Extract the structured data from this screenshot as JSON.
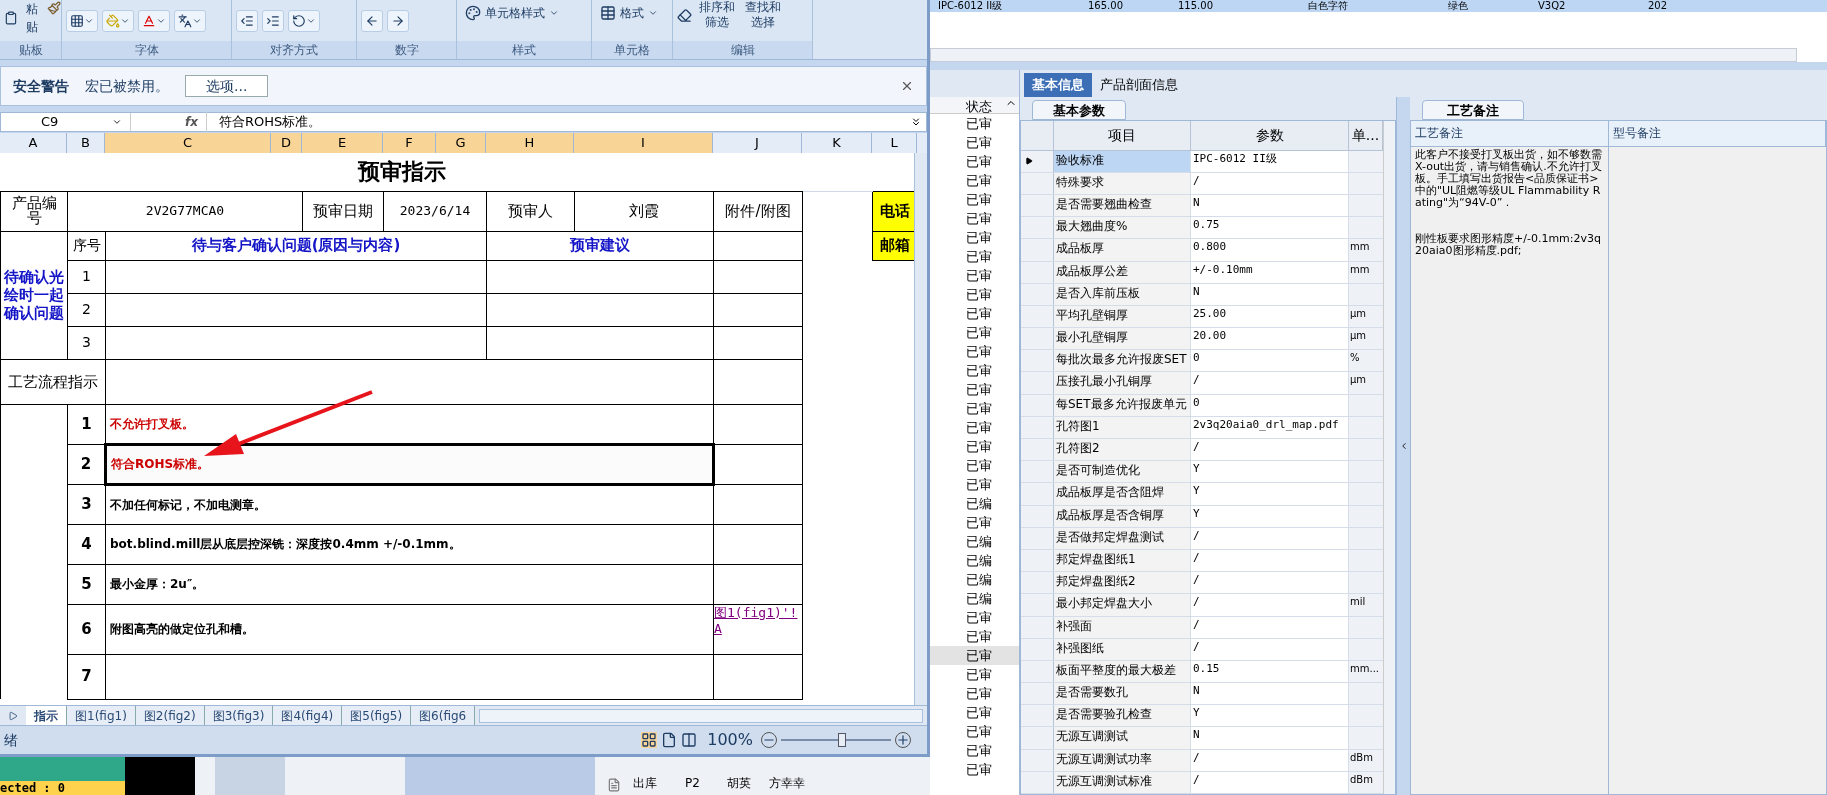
{
  "excel": {
    "ribbon": {
      "buttons": [
        "粘贴",
        "单元格样式",
        "格式",
        "排序和筛选",
        "查找和选择"
      ],
      "groups": [
        "贴板",
        "字体",
        "对齐方式",
        "数字",
        "样式",
        "单元格",
        "编辑"
      ]
    },
    "security_bar": {
      "title": "安全警告",
      "message": "宏已被禁用。",
      "button": "选项..."
    },
    "formula_bar": {
      "cell": "C9",
      "fx": "fx",
      "value": "符合ROHS标准。"
    },
    "columns": [
      {
        "label": "A",
        "selected": false
      },
      {
        "label": "B",
        "selected": false
      },
      {
        "label": "C",
        "selected": true
      },
      {
        "label": "D",
        "selected": true
      },
      {
        "label": "E",
        "selected": true
      },
      {
        "label": "F",
        "selected": true
      },
      {
        "label": "G",
        "selected": true
      },
      {
        "label": "H",
        "selected": true
      },
      {
        "label": "I",
        "selected": true
      },
      {
        "label": "J",
        "selected": false
      },
      {
        "label": "K",
        "selected": false
      },
      {
        "label": "L",
        "selected": false
      }
    ],
    "sheet": {
      "title": "预审指示",
      "product": {
        "label": "产品编号",
        "code": "2V2G77MCA0",
        "date_label": "预审日期",
        "date": "2023/6/14",
        "reviewer_label": "预审人",
        "reviewer": "刘霞",
        "attachment_label": "附件/附图",
        "phone": "电话",
        "email": "邮箱"
      },
      "confirm": {
        "side_label": "待确认光绘时一起确认问题",
        "no_header": "序号",
        "question_header": "待与客户确认问题(原因与内容)",
        "advice_header": "预审建议",
        "rows": [
          "1",
          "2",
          "3"
        ]
      },
      "process": {
        "label": "工艺流程指示",
        "steps": [
          {
            "no": "1",
            "text": "不允许打叉板。",
            "emphasis": true,
            "selected": false
          },
          {
            "no": "2",
            "text": "符合ROHS标准。",
            "emphasis": true,
            "selected": true
          },
          {
            "no": "3",
            "text": "不加任何标记，不加电测章。",
            "emphasis": false,
            "selected": false
          },
          {
            "no": "4",
            "text": "bot.blind.mill层从底层控深铣：深度按0.4mm  +/-0.1mm。",
            "emphasis": false,
            "selected": false
          },
          {
            "no": "5",
            "text": "最小金厚：2u″。",
            "emphasis": false,
            "selected": false
          },
          {
            "no": "6",
            "text": "附图高亮的做定位孔和槽。",
            "emphasis": false,
            "selected": false,
            "link": "图1(fig1)'!A"
          },
          {
            "no": "7",
            "selected": false
          }
        ]
      }
    },
    "sheet_tabs": [
      {
        "label": "指示",
        "selected": true
      },
      {
        "label": "图1(fig1)",
        "selected": false
      },
      {
        "label": "图2(fig2)",
        "selected": false
      },
      {
        "label": "图3(fig3)",
        "selected": false
      },
      {
        "label": "图4(fig4)",
        "selected": false
      },
      {
        "label": "图5(fig5)",
        "selected": false
      },
      {
        "label": "图6(fig6",
        "selected": false
      }
    ],
    "status_bar": {
      "text": "绪",
      "zoom": "100%",
      "level": 0.55
    }
  },
  "background": {
    "selection_count": "ected : 0",
    "tree_row": {
      "column_1": "出库",
      "column_2": "P2",
      "column_3": "胡英",
      "column_4": "方幸幸"
    },
    "top_row": [
      "IPC-6012 II级",
      "165.00",
      "115.00",
      "白色字符",
      "绿色",
      "V3Q2",
      "202"
    ],
    "status_list": {
      "header": "状态",
      "rows": [
        {
          "text": "已审",
          "selected": false
        },
        {
          "text": "已审",
          "selected": false
        },
        {
          "text": "已审",
          "selected": false
        },
        {
          "text": "已审",
          "selected": false
        },
        {
          "text": "已审",
          "selected": false
        },
        {
          "text": "已审",
          "selected": false
        },
        {
          "text": "已审",
          "selected": false
        },
        {
          "text": "已审",
          "selected": false
        },
        {
          "text": "已审",
          "selected": false
        },
        {
          "text": "已审",
          "selected": false
        },
        {
          "text": "已审",
          "selected": false
        },
        {
          "text": "已审",
          "selected": false
        },
        {
          "text": "已审",
          "selected": false
        },
        {
          "text": "已审",
          "selected": false
        },
        {
          "text": "已审",
          "selected": false
        },
        {
          "text": "已审",
          "selected": false
        },
        {
          "text": "已审",
          "selected": false
        },
        {
          "text": "已审",
          "selected": false
        },
        {
          "text": "已审",
          "selected": false
        },
        {
          "text": "已审",
          "selected": false
        },
        {
          "text": "已编",
          "selected": false
        },
        {
          "text": "已审",
          "selected": false
        },
        {
          "text": "已编",
          "selected": false
        },
        {
          "text": "已编",
          "selected": false
        },
        {
          "text": "已编",
          "selected": false
        },
        {
          "text": "已编",
          "selected": false
        },
        {
          "text": "已审",
          "selected": false
        },
        {
          "text": "已审",
          "selected": false
        },
        {
          "text": "已审",
          "selected": true
        },
        {
          "text": "已审",
          "selected": false
        },
        {
          "text": "已审",
          "selected": false
        },
        {
          "text": "已审",
          "selected": false
        },
        {
          "text": "已审",
          "selected": false
        },
        {
          "text": "已审",
          "selected": false
        },
        {
          "text": "已审",
          "selected": false
        }
      ]
    }
  },
  "info_panel": {
    "tabs": [
      {
        "label": "基本信息",
        "selected": true
      },
      {
        "label": "产品剖面信息",
        "selected": false
      }
    ],
    "params": {
      "tab": "基本参数",
      "columns": [
        "项目",
        "参数",
        "单..."
      ],
      "rows": [
        {
          "item": "验收标准",
          "value": "IPC-6012 II级",
          "unit": "",
          "selected": true
        },
        {
          "item": "特殊要求",
          "value": "/",
          "unit": "",
          "selected": false
        },
        {
          "item": "是否需要翘曲检查",
          "value": "N",
          "unit": "",
          "selected": false
        },
        {
          "item": "最大翘曲度%",
          "value": "0.75",
          "unit": "",
          "selected": false
        },
        {
          "item": "成品板厚",
          "value": "0.800",
          "unit": "mm",
          "selected": false
        },
        {
          "item": "成品板厚公差",
          "value": "+/-0.10mm",
          "unit": "mm",
          "selected": false
        },
        {
          "item": "是否入库前压板",
          "value": "N",
          "unit": "",
          "selected": false
        },
        {
          "item": "平均孔壁铜厚",
          "value": "25.00",
          "unit": "μm",
          "selected": false
        },
        {
          "item": "最小孔壁铜厚",
          "value": "20.00",
          "unit": "μm",
          "selected": false
        },
        {
          "item": "每批次最多允许报废SET",
          "value": "0",
          "unit": "%",
          "selected": false
        },
        {
          "item": "压接孔最小孔铜厚",
          "value": "/",
          "unit": "μm",
          "selected": false
        },
        {
          "item": "每SET最多允许报废单元",
          "value": "0",
          "unit": "",
          "selected": false
        },
        {
          "item": "孔符图1",
          "value": "2v3q20aia0_drl_map.pdf",
          "unit": "",
          "selected": false
        },
        {
          "item": "孔符图2",
          "value": "/",
          "unit": "",
          "selected": false
        },
        {
          "item": "是否可制造优化",
          "value": "Y",
          "unit": "",
          "selected": false
        },
        {
          "item": "成品板厚是否含阻焊",
          "value": "Y",
          "unit": "",
          "selected": false
        },
        {
          "item": "成品板厚是否含铜厚",
          "value": "Y",
          "unit": "",
          "selected": false
        },
        {
          "item": "是否做邦定焊盘测试",
          "value": "/",
          "unit": "",
          "selected": false
        },
        {
          "item": "邦定焊盘图纸1",
          "value": "/",
          "unit": "",
          "selected": false
        },
        {
          "item": "邦定焊盘图纸2",
          "value": "/",
          "unit": "",
          "selected": false
        },
        {
          "item": "最小邦定焊盘大小",
          "value": "/",
          "unit": "mil",
          "selected": false
        },
        {
          "item": "补强面",
          "value": "/",
          "unit": "",
          "selected": false
        },
        {
          "item": "补强图纸",
          "value": "/",
          "unit": "",
          "selected": false
        },
        {
          "item": "板面平整度的最大极差",
          "value": "0.15",
          "unit": "mm...",
          "selected": false
        },
        {
          "item": "是否需要数孔",
          "value": "N",
          "unit": "",
          "selected": false
        },
        {
          "item": "是否需要验孔检查",
          "value": "Y",
          "unit": "",
          "selected": false
        },
        {
          "item": "无源互调测试",
          "value": "N",
          "unit": "",
          "selected": false
        },
        {
          "item": "无源互调测试功率",
          "value": "/",
          "unit": "dBm",
          "selected": false
        },
        {
          "item": "无源互调测试标准",
          "value": "/",
          "unit": "dBm",
          "selected": false
        }
      ]
    },
    "notes": {
      "tab": "工艺备注",
      "columns": [
        "工艺备注",
        "型号备注"
      ],
      "paragraphs": [
        "此客户不接受打叉板出货，如不够数需X-out出货，请与销售确认.不允许打叉板。手工填写出货报告<品质保证书>中的\"UL阻燃等级UL Flammability Rating\"为“94V-0” .",
        "刚性板要求图形精度+/-0.1mm:2v3q20aia0图形精度.pdf;"
      ]
    }
  }
}
